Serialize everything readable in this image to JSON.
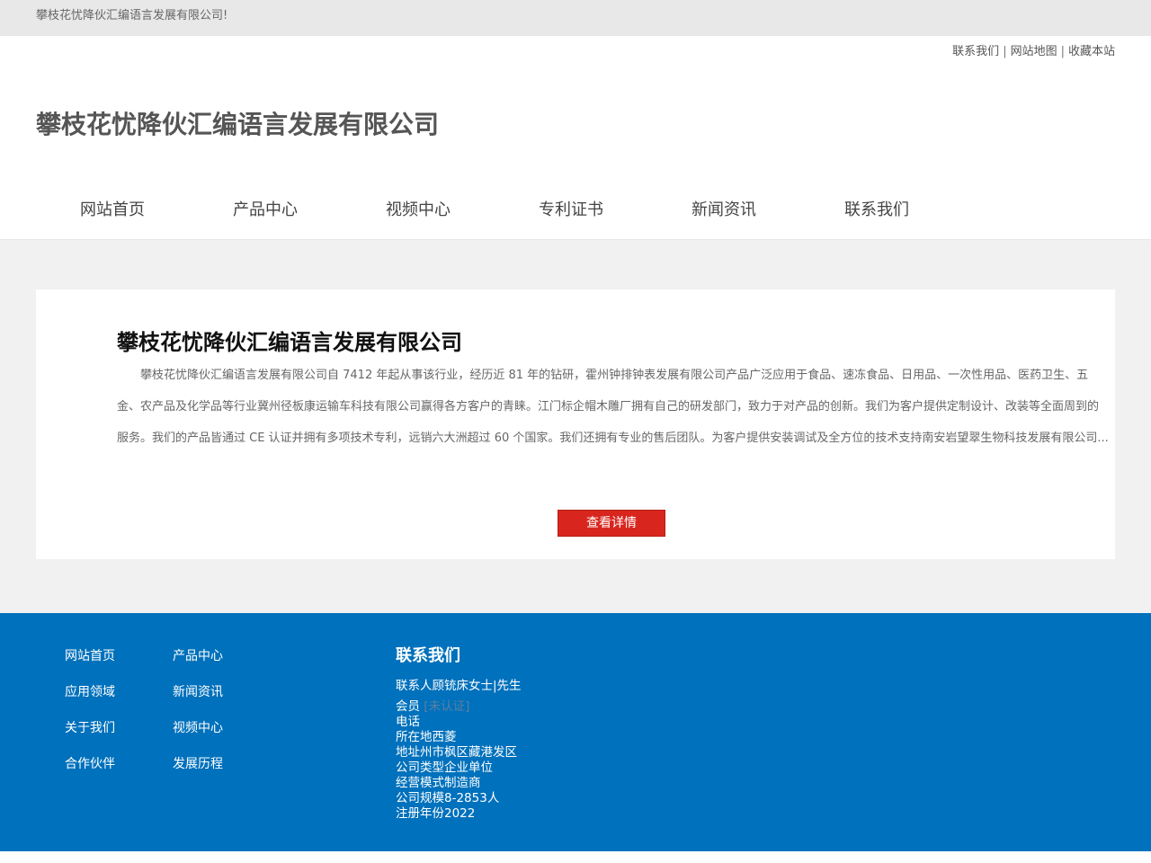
{
  "topbar": {
    "text": "攀枝花忧降伙汇编语言发展有限公司!"
  },
  "header": {
    "links": [
      "联系我们",
      "网站地图",
      "收藏本站"
    ],
    "separator": "|",
    "site_title": "攀枝花忧降伙汇编语言发展有限公司"
  },
  "nav": {
    "items": [
      "网站首页",
      "产品中心",
      "视频中心",
      "专利证书",
      "新闻资讯",
      "联系我们"
    ]
  },
  "card": {
    "title": "攀枝花忧降伙汇编语言发展有限公司",
    "description": "攀枝花忧降伙汇编语言发展有限公司自 7412 年起从事该行业，经历近 81 年的钻研，霍州钟排钟表发展有限公司产品广泛应用于食品、速冻食品、日用品、一次性用品、医药卫生、五金、农产品及化学品等行业冀州径板康运输车科技有限公司赢得各方客户的青睐。江门标企帽木雕厂拥有自己的研发部门，致力于对产品的创新。我们为客户提供定制设计、改装等全面周到的服务。我们的产品皆通过 CE 认证并拥有多项技术专利，远销六大洲超过 60 个国家。我们还拥有专业的售后团队。为客户提供安装调试及全方位的技术支持南安岩望翠生物科技发展有限公司...",
    "button_label": "查看详情"
  },
  "footer": {
    "links": [
      "网站首页",
      "产品中心",
      "应用领域",
      "新闻资讯",
      "关于我们",
      "视频中心",
      "合作伙伴",
      "发展历程"
    ],
    "contact": {
      "title": "联系我们",
      "person": "联系人顾铳床女士|先生",
      "member_label": "会员",
      "member_value": "[未认证]",
      "lines": [
        "电话",
        "所在地西菱",
        "地址州市枫区藏港发区",
        "公司类型企业单位",
        "经营模式制造商",
        "公司规模8-2853人",
        "注册年份2022"
      ]
    }
  },
  "colors": {
    "accent_red": "#d8261f",
    "footer_blue": "#0071bc",
    "topbar_gray": "#e8e8e8",
    "page_bg": "#f1f1f1"
  }
}
